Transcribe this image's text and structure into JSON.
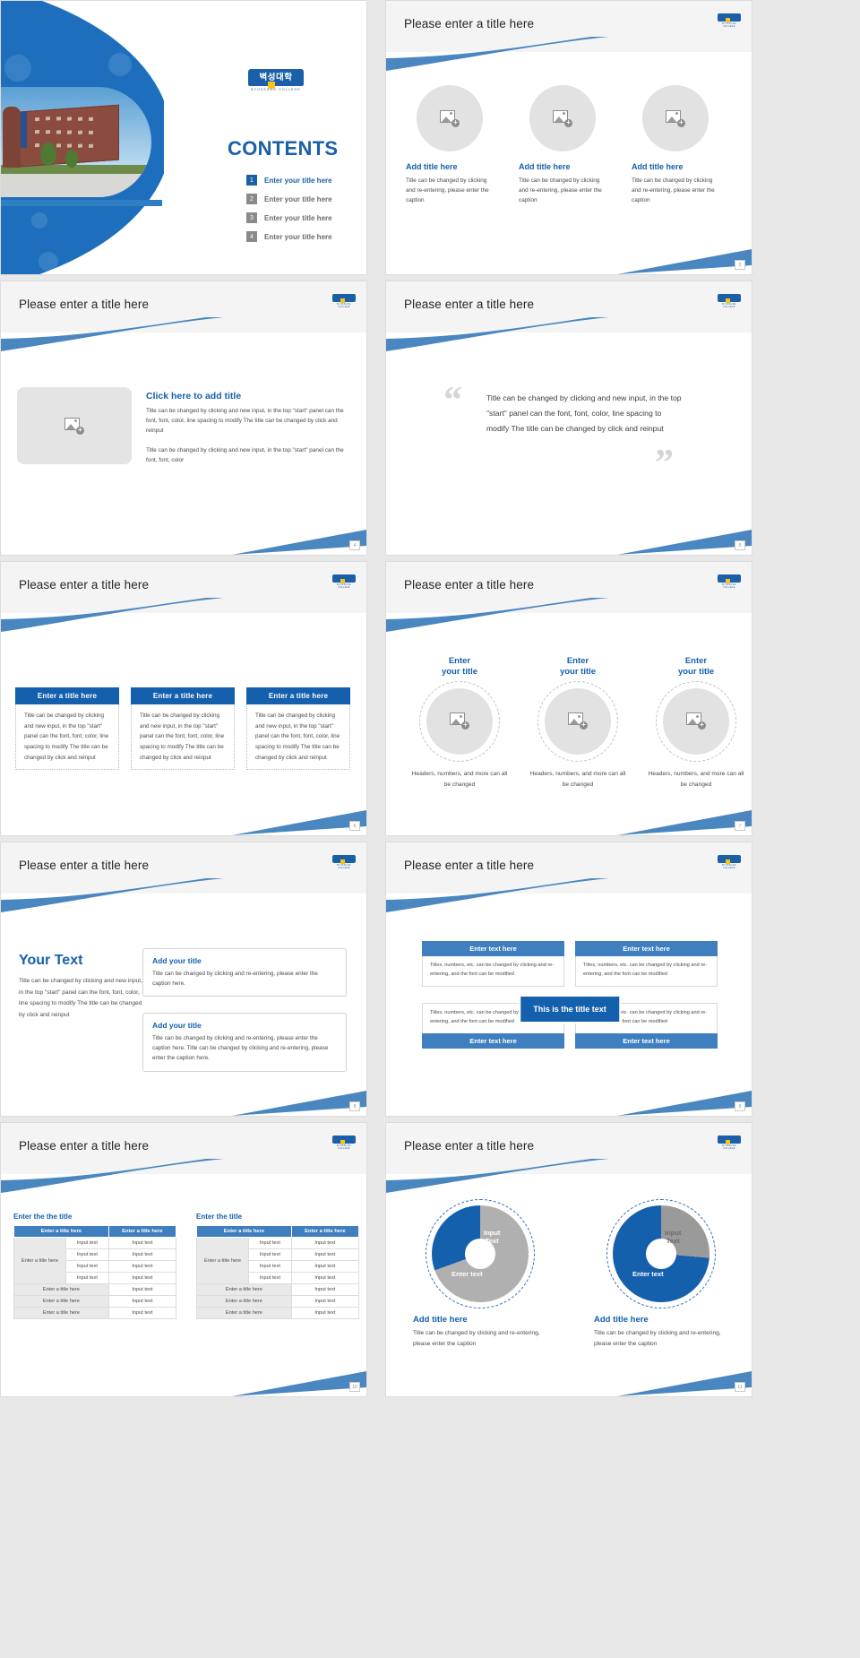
{
  "common": {
    "slide_title": "Please enter a title here",
    "logo_text": "벽성대학",
    "logo_sub": "BYUKSUNG COLLEGE"
  },
  "cover": {
    "contents_heading": "CONTENTS",
    "toc": [
      {
        "num": "1",
        "label": "Enter your title here"
      },
      {
        "num": "2",
        "label": "Enter your title here"
      },
      {
        "num": "3",
        "label": "Enter your title here"
      },
      {
        "num": "4",
        "label": "Enter your title here"
      }
    ]
  },
  "slide2": {
    "page": "2",
    "items": [
      {
        "title": "Add title here",
        "body": "Title can be changed by clicking and re-entering, please enter the caption"
      },
      {
        "title": "Add title here",
        "body": "Title can be changed by clicking and re-entering, please enter the caption"
      },
      {
        "title": "Add title here",
        "body": "Title can be changed by clicking and re-entering, please enter the caption"
      }
    ]
  },
  "slide3": {
    "page": "4",
    "title": "Click here to add title",
    "para1": "Title can be changed by clicking and new input, in the top \"start\" panel can the font, font, color, line spacing to modify The title can be changed by click and reinput",
    "para2": "Title can be changed by clicking and new input, in the top \"start\" panel can the font, font, color"
  },
  "slide4": {
    "page": "5",
    "quote": "Title can be changed by clicking and new input, in the top \"start\" panel can the font, font, color, line spacing to modify The title can be changed by click and reinput",
    "open_quote": "“",
    "close_quote": "”"
  },
  "slide5": {
    "page": "6",
    "columns": [
      {
        "head": "Enter a title here",
        "body": "Title can be changed by clicking and new input, in the top \"start\" panel can the font, font, color, line spacing to modify The title can be changed by click and reinput"
      },
      {
        "head": "Enter a title here",
        "body": "Title can be changed by clicking and new input, in the top \"start\" panel can the font, font, color, line spacing to modify The title can be changed by click and reinput"
      },
      {
        "head": "Enter a title here",
        "body": "Title can be changed by clicking and new input, in the top \"start\" panel can the font, font, color, line spacing to modify The title can be changed by click and reinput"
      }
    ]
  },
  "slide6": {
    "page": "7",
    "items": [
      {
        "title": "Enter\nyour title",
        "caption": "Headers, numbers, and more can all be changed"
      },
      {
        "title": "Enter\nyour title",
        "caption": "Headers, numbers, and more can all be changed"
      },
      {
        "title": "Enter\nyour title",
        "caption": "Headers, numbers, and more can all be changed"
      }
    ]
  },
  "slide7": {
    "page": "8",
    "heading": "Your Text",
    "body": "Title can be changed by clicking and new input, in the top \"start\" panel can the font, font, color, line spacing to modify The title can be changed by click and reinput",
    "boxes": [
      {
        "title": "Add your title",
        "body": "Title can be changed by clicking and re-entering, please enter the caption here."
      },
      {
        "title": "Add your title",
        "body": "Title can be changed by clicking and re-entering, please enter the caption here. Title can be changed by clicking and re-entering, please enter the caption here."
      }
    ]
  },
  "slide8": {
    "page": "9",
    "center_label": "This is the title text",
    "top_heads": [
      "Enter text here",
      "Enter text here"
    ],
    "bottom_heads": [
      "Enter text here",
      "Enter text here"
    ],
    "cells": [
      "Titles, numbers, etc. can be changed by clicking and re-entering, and the font can be modified",
      "Titles, numbers, etc. can be changed by clicking and re-entering, and the font can be modified",
      "Titles, numbers, etc. can be changed by clicking and re-entering, and the font can be modified",
      "Titles, numbers, etc. can be changed by clicking and re-entering, and the font can be modified"
    ]
  },
  "slide9": {
    "page": "10",
    "blocks": [
      {
        "caption": "Enter the the title",
        "headers": [
          "Enter a title here",
          "Enter a title here"
        ],
        "merged_label": "Enter a title here",
        "merged_rows": [
          "Input text",
          "Input text",
          "Input text",
          "Input text"
        ],
        "merged_rows2": [
          "Input text",
          "Input text",
          "Input text",
          "Input text"
        ],
        "plain_rows": [
          [
            "Enter a title here",
            "Input text"
          ],
          [
            "Enter a title here",
            "Input text"
          ],
          [
            "Enter a title here",
            "Input text"
          ]
        ]
      },
      {
        "caption": "Enter the title",
        "headers": [
          "Enter a title here",
          "Enter a title here"
        ],
        "merged_label": "Enter a title here",
        "merged_rows": [
          "Input text",
          "Input text",
          "Input text",
          "Input text"
        ],
        "merged_rows2": [
          "Input text",
          "Input text",
          "Input text",
          "Input text"
        ],
        "plain_rows": [
          [
            "Enter a title here",
            "Input text"
          ],
          [
            "Enter a title here",
            "Input text"
          ],
          [
            "Enter a title here",
            "Input text"
          ]
        ]
      }
    ]
  },
  "slide10": {
    "page": "11",
    "items": [
      {
        "inner_label": "Input\nText",
        "arc_label": "Enter text",
        "title": "Add title here",
        "body": "Title can be changed by clicking and re-entering, please enter the caption"
      },
      {
        "inner_label": "Input\nText",
        "arc_label": "Enter text",
        "title": "Add title here",
        "body": "Title can be changed by clicking and re-entering, please enter the caption"
      }
    ]
  },
  "colors": {
    "brand_blue": "#1560ad",
    "accent_blue": "#3f7fbf",
    "cover_blue": "#1d6fbd",
    "header_bg": "#f4f4f4",
    "placeholder_grey": "#e2e2e2",
    "logo_yellow": "#f5c518"
  }
}
